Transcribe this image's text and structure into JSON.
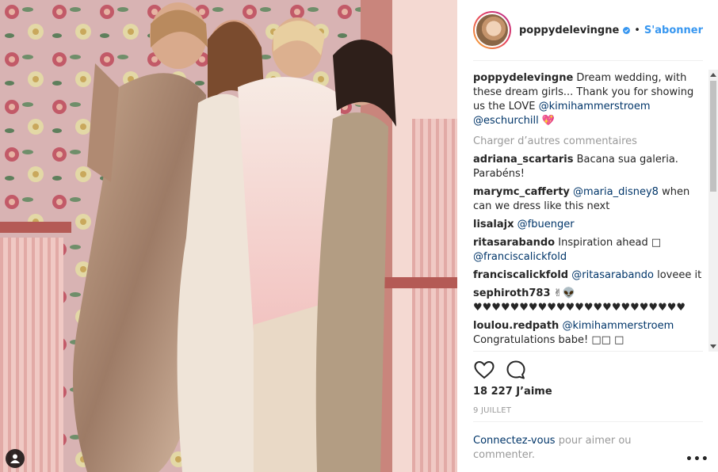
{
  "post": {
    "username": "poppydelevingne",
    "follow_label": "S'abonner",
    "separator": "•",
    "caption_text": "Dream wedding, with these dream girls... Thank you for showing us the LOVE",
    "caption_mention_1": "@kimihammerstroem",
    "caption_mention_2": "@eschurchill",
    "caption_emoji": "💖",
    "load_more": "Charger d’autres commentaires",
    "likes": "18 227 J’aime",
    "date": "9 JUILLET",
    "login_link": "Connectez-vous",
    "login_text": " pour aimer ou commenter.",
    "more_label": "•••"
  },
  "comments": [
    {
      "user": "adriana_scartaris",
      "text": "Bacana sua galeria. Parabéns!",
      "mention": ""
    },
    {
      "user": "marymc_cafferty",
      "text": "when can we dress like this next",
      "mention": "@maria_disney8"
    },
    {
      "user": "lisalajx",
      "text": "",
      "mention": "@fbuenger"
    },
    {
      "user": "ritasarabando",
      "text": "Inspiration ahead □",
      "mention": "@franciscalickfold"
    },
    {
      "user": "franciscalickfold",
      "text": "loveee it",
      "mention": "@ritasarabando"
    },
    {
      "user": "sephiroth783",
      "text": "✌👽 ♥♥♥♥♥♥♥♥♥♥♥♥♥♥♥♥♥♥♥♥♥♥♥",
      "mention": ""
    },
    {
      "user": "loulou.redpath",
      "text": "Congratulations babe! □□ □",
      "mention": "@kimihammerstroem"
    }
  ],
  "icons": {
    "verified": "verified-badge-icon",
    "like": "heart-icon",
    "comment": "comment-bubble-icon",
    "tag": "user-tag-icon"
  },
  "colors": {
    "link_blue": "#3897f0",
    "mention_dark": "#003569",
    "muted": "#999999"
  }
}
